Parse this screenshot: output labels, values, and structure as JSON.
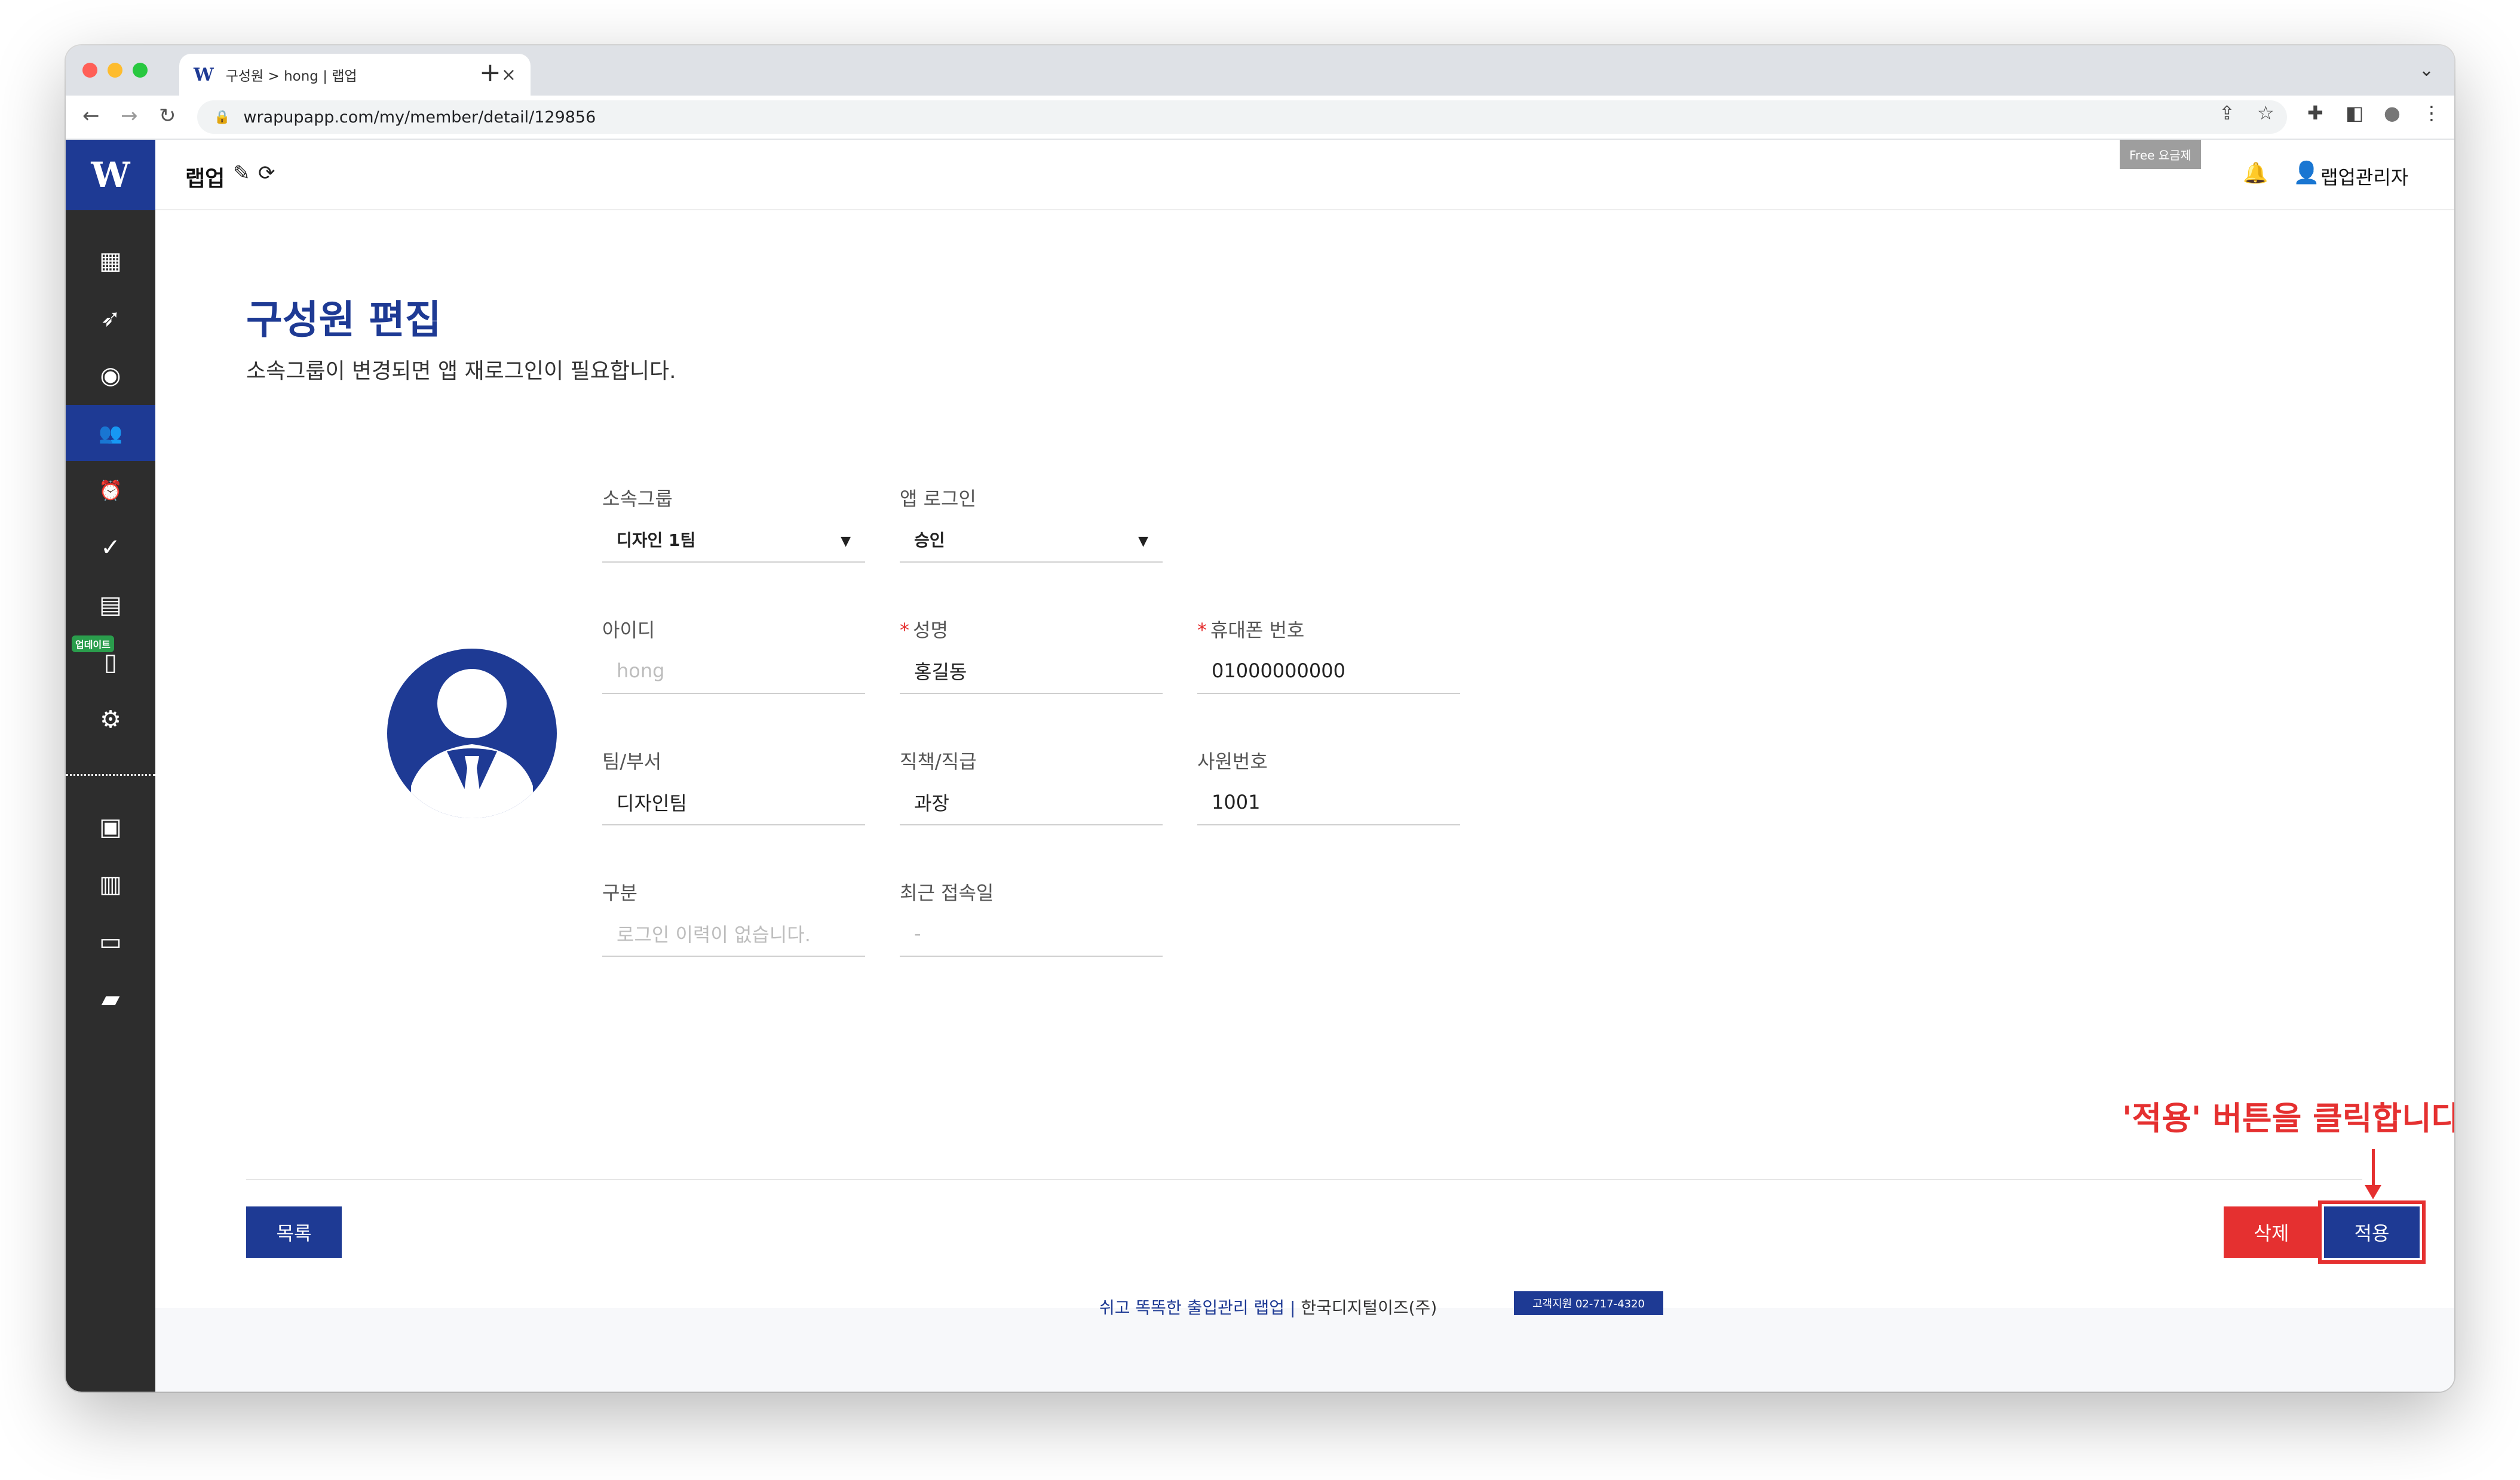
{
  "browser": {
    "tab_title": "구성원 > hong | 랩업",
    "tab_favicon": "W",
    "tab_close": "×",
    "new_tab": "+",
    "tab_menu": "⌄",
    "url": "wrapupapp.com/my/member/detail/129856",
    "nav": {
      "back": "←",
      "forward": "→",
      "reload": "↻"
    },
    "lock": "🔒",
    "share_icon": "⇪",
    "star_icon": "☆",
    "extensions_icon": "✚",
    "sidepanel_icon": "◧",
    "profile_icon": "●",
    "menu_icon": "⋮"
  },
  "sidebar": {
    "logo": "W",
    "update_badge": "업데이트",
    "items": [
      {
        "icon": "dashboard-icon",
        "glyph": "▦"
      },
      {
        "icon": "rocket-icon",
        "glyph": "➶"
      },
      {
        "icon": "palette-icon",
        "glyph": "◉"
      },
      {
        "icon": "members-icon",
        "glyph": "👥"
      },
      {
        "icon": "alarm-icon",
        "glyph": "⏰"
      },
      {
        "icon": "check-icon",
        "glyph": "✓"
      },
      {
        "icon": "id-card-icon",
        "glyph": "▤"
      },
      {
        "icon": "phone-icon",
        "glyph": "▯"
      },
      {
        "icon": "gear-icon",
        "glyph": "⚙"
      },
      {
        "icon": "contact-icon",
        "glyph": "▣"
      },
      {
        "icon": "building-icon",
        "glyph": "▥"
      },
      {
        "icon": "store-icon",
        "glyph": "▭"
      },
      {
        "icon": "chat-icon",
        "glyph": "▰"
      }
    ]
  },
  "topbar": {
    "app_name": "랩업",
    "edit_glyph": "✎",
    "refresh_glyph": "⟳",
    "plan_badge": "Free 요금제",
    "bell_glyph": "🔔",
    "user_glyph": "👤",
    "user_name": "랩업관리자"
  },
  "page": {
    "title": "구성원 편집",
    "subtitle": "소속그룹이 변경되면 앱 재로그인이 필요합니다."
  },
  "form": {
    "group": {
      "label": "소속그룹",
      "value": "디자인 1팀"
    },
    "app_login": {
      "label": "앱 로그인",
      "value": "승인"
    },
    "id": {
      "label": "아이디",
      "value": "hong"
    },
    "name": {
      "required_mark": "*",
      "label": "성명",
      "value": "홍길동"
    },
    "phone": {
      "required_mark": "*",
      "label": "휴대폰 번호",
      "value": "01000000000"
    },
    "team": {
      "label": "팀/부서",
      "value": "디자인팀"
    },
    "position": {
      "label": "직책/직급",
      "value": "과장"
    },
    "employee_no": {
      "label": "사원번호",
      "value": "1001"
    },
    "category": {
      "label": "구분",
      "value": "로그인 이력이 없습니다."
    },
    "last_access": {
      "label": "최근 접속일",
      "value": "-"
    },
    "caret": "▼"
  },
  "buttons": {
    "list": "목록",
    "delete": "삭제",
    "apply": "적용"
  },
  "annotation": "'적용' 버튼을 클릭합니다.",
  "footer": {
    "slogan": "쉬고 똑똑한 출입관리 랩업",
    "separator": "|",
    "company": "한국디지털이즈(주)",
    "support": "고객지원 02-717-4320"
  },
  "colors": {
    "brand": "#1e3a94",
    "danger": "#e53030",
    "sidebar": "#2d2d2d",
    "update_badge": "#2a9d4c"
  }
}
